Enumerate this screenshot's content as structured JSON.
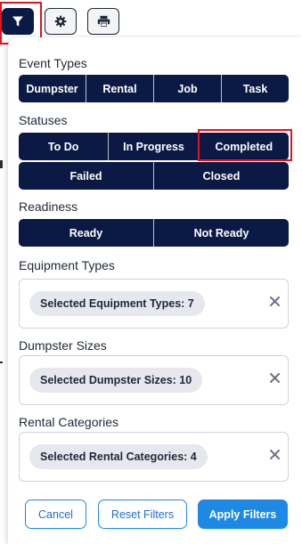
{
  "toolbar": {
    "filter_icon": "filter-icon",
    "settings_icon": "gear-icon",
    "print_icon": "printer-icon"
  },
  "sections": {
    "event_types": {
      "title": "Event Types",
      "options": [
        "Dumpster",
        "Rental",
        "Job",
        "Task"
      ]
    },
    "statuses": {
      "title": "Statuses",
      "row1": [
        "To Do",
        "In Progress",
        "Completed"
      ],
      "row2": [
        "Failed",
        "Closed"
      ]
    },
    "readiness": {
      "title": "Readiness",
      "options": [
        "Ready",
        "Not Ready"
      ]
    },
    "equipment_types": {
      "title": "Equipment Types",
      "chip": "Selected Equipment Types: 7"
    },
    "dumpster_sizes": {
      "title": "Dumpster Sizes",
      "chip": "Selected Dumpster Sizes: 10"
    },
    "rental_categories": {
      "title": "Rental Categories",
      "chip": "Selected Rental Categories: 4"
    }
  },
  "actions": {
    "cancel": "Cancel",
    "reset": "Reset Filters",
    "apply": "Apply Filters"
  },
  "colors": {
    "navy": "#0b1a44",
    "primary": "#1e88e5",
    "highlight": "#e0141e"
  }
}
